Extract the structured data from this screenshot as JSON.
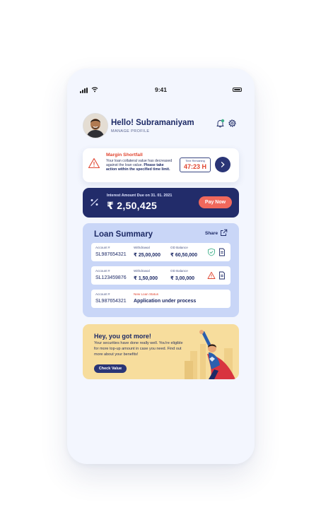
{
  "status_bar": {
    "time": "9:41"
  },
  "header": {
    "greeting": "Hello! Subramaniyam",
    "manage_profile": "MANAGE PROFILE"
  },
  "alert": {
    "title": "Margin Shortfall",
    "body_line": "Your loan collateral value has decreased against the loan value.",
    "body_action": "Please take action within the specified time limit.",
    "time_label": "Time Remaining",
    "time_value": "47:23 H"
  },
  "interest": {
    "label": "Interest Amount Due on 31. 01. 2021",
    "amount": "₹ 2,50,425",
    "pay_label": "Pay Now"
  },
  "loan_summary": {
    "title": "Loan Summary",
    "share_label": "Share",
    "rows": [
      {
        "c1_label": "Account #",
        "c1_value": "SL987654321",
        "c2_label": "Withdrawal",
        "c2_value": "₹ 25,00,000",
        "c3_label": "OD Balance",
        "c3_value": "₹ 60,50,000"
      },
      {
        "c1_label": "Account #",
        "c1_value": "SL123459876",
        "c2_label": "Withdrawal",
        "c2_value": "₹ 1,50,000",
        "c3_label": "OD Balance",
        "c3_value": "₹ 3,00,000"
      },
      {
        "c1_label": "Account #",
        "c1_value": "SL987654321",
        "c2_label": "New Loan Status",
        "c2_value": "Application under process"
      }
    ]
  },
  "promo": {
    "title": "Hey, you got more!",
    "text": "Your securities have done really well. You're eligible for more top-up amount in case you need. Find out more about your benefits!",
    "button": "Check Value"
  },
  "colors": {
    "navy": "#222c6a",
    "alert_red": "#e0442f",
    "pay_coral": "#f0685c",
    "summary_bg": "#c9d6f7",
    "promo_bg": "#f7dd9d",
    "phone_bg": "#f3f6fe"
  }
}
